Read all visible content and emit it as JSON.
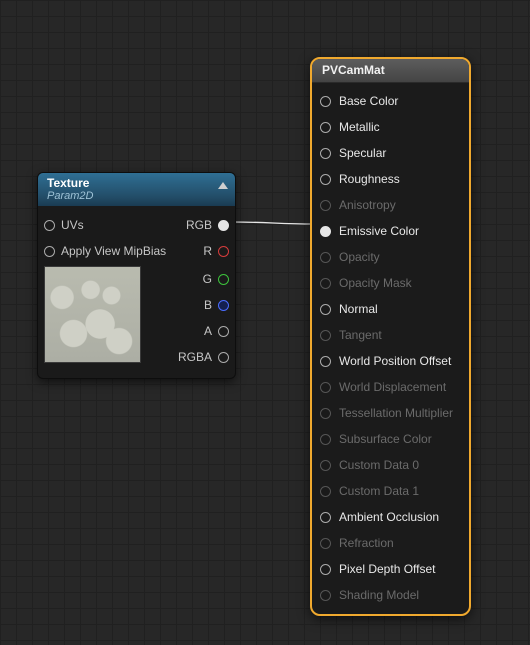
{
  "texture_node": {
    "title": "Texture",
    "subtitle": "Param2D",
    "inputs": {
      "uvs": "UVs",
      "mipbias": "Apply View MipBias"
    },
    "outputs": {
      "rgb": "RGB",
      "r": "R",
      "g": "G",
      "b": "B",
      "a": "A",
      "rgba": "RGBA"
    }
  },
  "material_node": {
    "title": "PVCamMat",
    "pins": [
      {
        "key": "base_color",
        "label": "Base Color",
        "enabled": true,
        "filled": false
      },
      {
        "key": "metallic",
        "label": "Metallic",
        "enabled": true,
        "filled": false
      },
      {
        "key": "specular",
        "label": "Specular",
        "enabled": true,
        "filled": false
      },
      {
        "key": "roughness",
        "label": "Roughness",
        "enabled": true,
        "filled": false
      },
      {
        "key": "anisotropy",
        "label": "Anisotropy",
        "enabled": false,
        "filled": false
      },
      {
        "key": "emissive",
        "label": "Emissive Color",
        "enabled": true,
        "filled": true
      },
      {
        "key": "opacity",
        "label": "Opacity",
        "enabled": false,
        "filled": false
      },
      {
        "key": "opacity_mask",
        "label": "Opacity Mask",
        "enabled": false,
        "filled": false
      },
      {
        "key": "normal",
        "label": "Normal",
        "enabled": true,
        "filled": false
      },
      {
        "key": "tangent",
        "label": "Tangent",
        "enabled": false,
        "filled": false
      },
      {
        "key": "wpo",
        "label": "World Position Offset",
        "enabled": true,
        "filled": false
      },
      {
        "key": "world_disp",
        "label": "World Displacement",
        "enabled": false,
        "filled": false
      },
      {
        "key": "tess_mult",
        "label": "Tessellation Multiplier",
        "enabled": false,
        "filled": false
      },
      {
        "key": "subsurface",
        "label": "Subsurface Color",
        "enabled": false,
        "filled": false
      },
      {
        "key": "custom0",
        "label": "Custom Data 0",
        "enabled": false,
        "filled": false
      },
      {
        "key": "custom1",
        "label": "Custom Data 1",
        "enabled": false,
        "filled": false
      },
      {
        "key": "ao",
        "label": "Ambient Occlusion",
        "enabled": true,
        "filled": false
      },
      {
        "key": "refraction",
        "label": "Refraction",
        "enabled": false,
        "filled": false
      },
      {
        "key": "pdo",
        "label": "Pixel Depth Offset",
        "enabled": true,
        "filled": false
      },
      {
        "key": "shading_model",
        "label": "Shading Model",
        "enabled": false,
        "filled": false
      }
    ]
  },
  "connection": {
    "from": "rgb",
    "to": "emissive"
  }
}
